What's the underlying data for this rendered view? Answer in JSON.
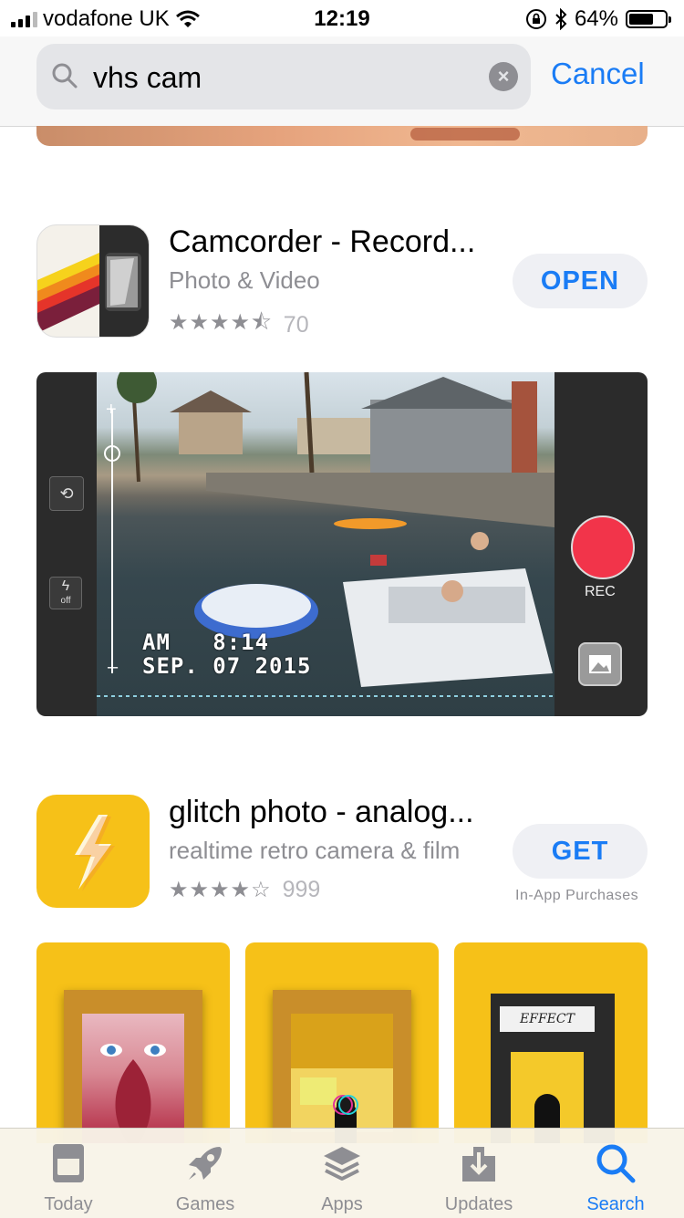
{
  "status_bar": {
    "carrier": "vodafone UK",
    "time": "12:19",
    "battery": "64%"
  },
  "search": {
    "query": "vhs cam",
    "cancel_label": "Cancel"
  },
  "results": [
    {
      "name": "Camcorder - Record...",
      "subtitle": "Photo & Video",
      "stars": "★★★★⯪",
      "rating_value": 4.5,
      "rating_count": "70",
      "button": "OPEN",
      "screenshot": {
        "osd_line1": "AM   8:14",
        "osd_line2": "SEP. 07 2015",
        "rec_label": "REC",
        "flash_label": "off"
      }
    },
    {
      "name": "glitch photo - analog...",
      "subtitle": "realtime retro camera & film",
      "stars": "★★★★☆",
      "rating_value": 4,
      "rating_count": "999",
      "button": "GET",
      "in_app_purchases": "In-App Purchases",
      "screenshot_text": "EFFECT"
    }
  ],
  "tab_bar": {
    "items": [
      {
        "label": "Today",
        "icon": "today-icon"
      },
      {
        "label": "Games",
        "icon": "rocket-icon"
      },
      {
        "label": "Apps",
        "icon": "layers-icon"
      },
      {
        "label": "Updates",
        "icon": "download-icon"
      },
      {
        "label": "Search",
        "icon": "search-icon",
        "active": true
      }
    ]
  },
  "colors": {
    "accent": "#1a7cf5",
    "rec_button": "#f2344a",
    "glitch_yellow": "#f6c118"
  }
}
